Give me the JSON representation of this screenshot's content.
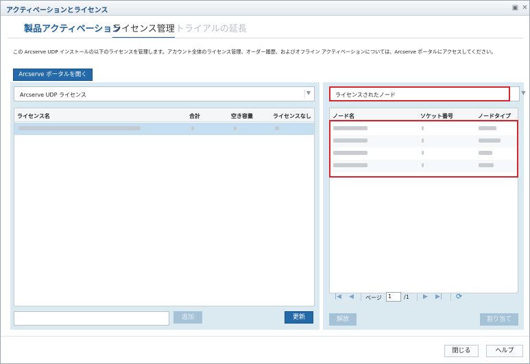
{
  "window": {
    "title": "アクティベーションとライセンス"
  },
  "tabs": [
    {
      "label": "製品アクティベーション"
    },
    {
      "label": "ライセンス管理"
    },
    {
      "label": "トライアルの延長"
    }
  ],
  "description": "この Arcserve UDP インストールの以下のライセンスを管理します。アカウント全体のライセンス管理、オーダー履歴、およびオフライン アクティベーションについては、Arcserve ポータルにアクセスしてください。",
  "portal_button": "Arcserve ポータルを開く",
  "left_panel": {
    "selected_license": "Arcserve UDP ライセンス",
    "columns": [
      "ライセンス名",
      "合計",
      "空き容量",
      "ライセンスなし"
    ],
    "add_button": "追加",
    "update_button": "更新",
    "input_value": ""
  },
  "right_panel": {
    "selected_filter": "ライセンスされたノード",
    "columns": [
      "ノード名",
      "ソケット番号",
      "ノードタイプ"
    ],
    "pager": {
      "page_label": "ページ",
      "page_value": "1",
      "total": "/1"
    },
    "release_button": "解放",
    "assign_button": "割り当て"
  },
  "footer": {
    "close_button": "閉じる",
    "help_button": "ヘルプ"
  },
  "colors": {
    "accent": "#2469a8",
    "panel": "#dbe9f1",
    "highlight": "#d8222c",
    "selected_row": "#c6dff0"
  }
}
